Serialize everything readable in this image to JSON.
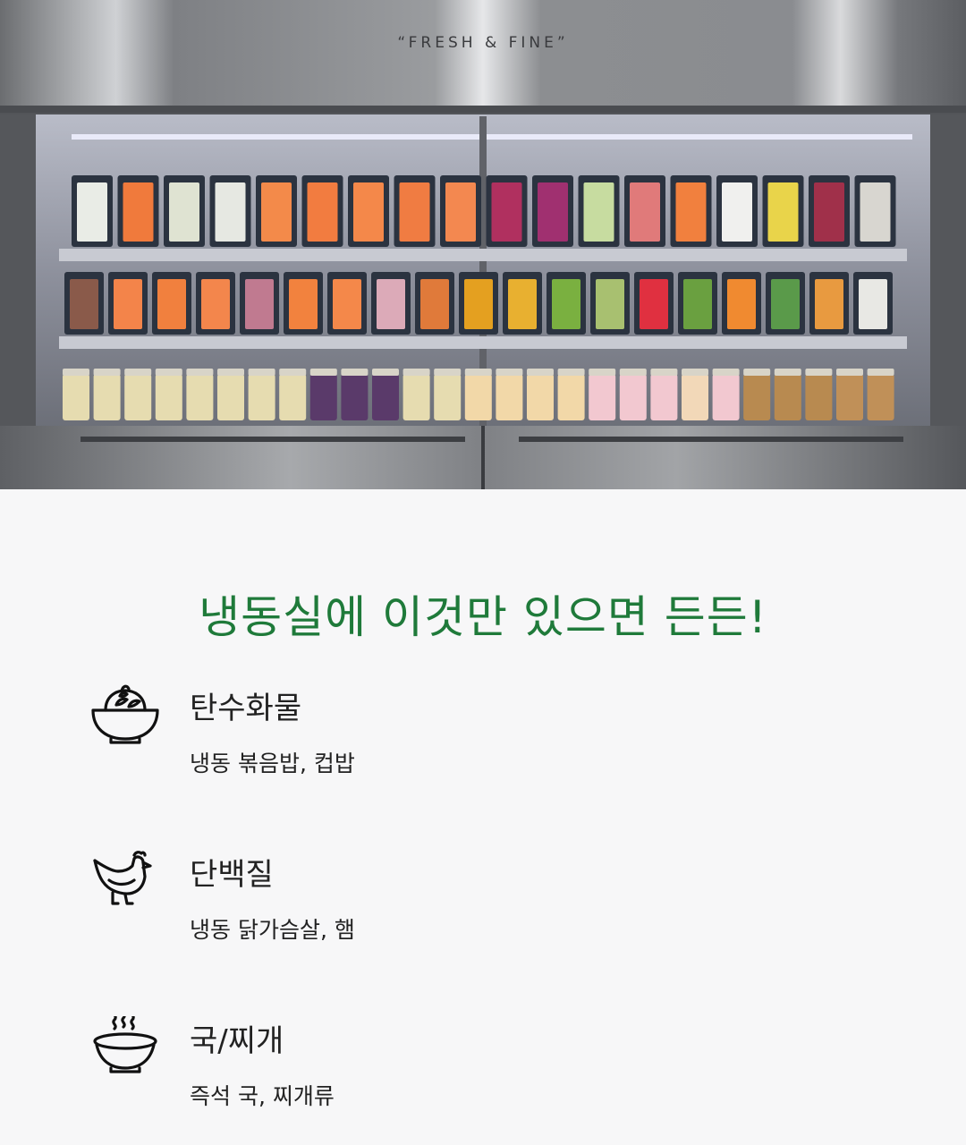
{
  "photo": {
    "brand_text": "“FRESH & FINE”"
  },
  "headline": "냉동실에 이것만 있으면 든든!",
  "categories": [
    {
      "icon": "rice-bowl-icon",
      "title": "탄수화물",
      "subtitle": "냉동 볶음밥, 컵밥"
    },
    {
      "icon": "chicken-icon",
      "title": "단백질",
      "subtitle": "냉동 닭가슴살, 햄"
    },
    {
      "icon": "soup-bowl-icon",
      "title": "국/찌개",
      "subtitle": "즉석 국, 찌개류"
    }
  ],
  "colors": {
    "headline": "#1f7a3a",
    "background": "#f7f7f8"
  }
}
